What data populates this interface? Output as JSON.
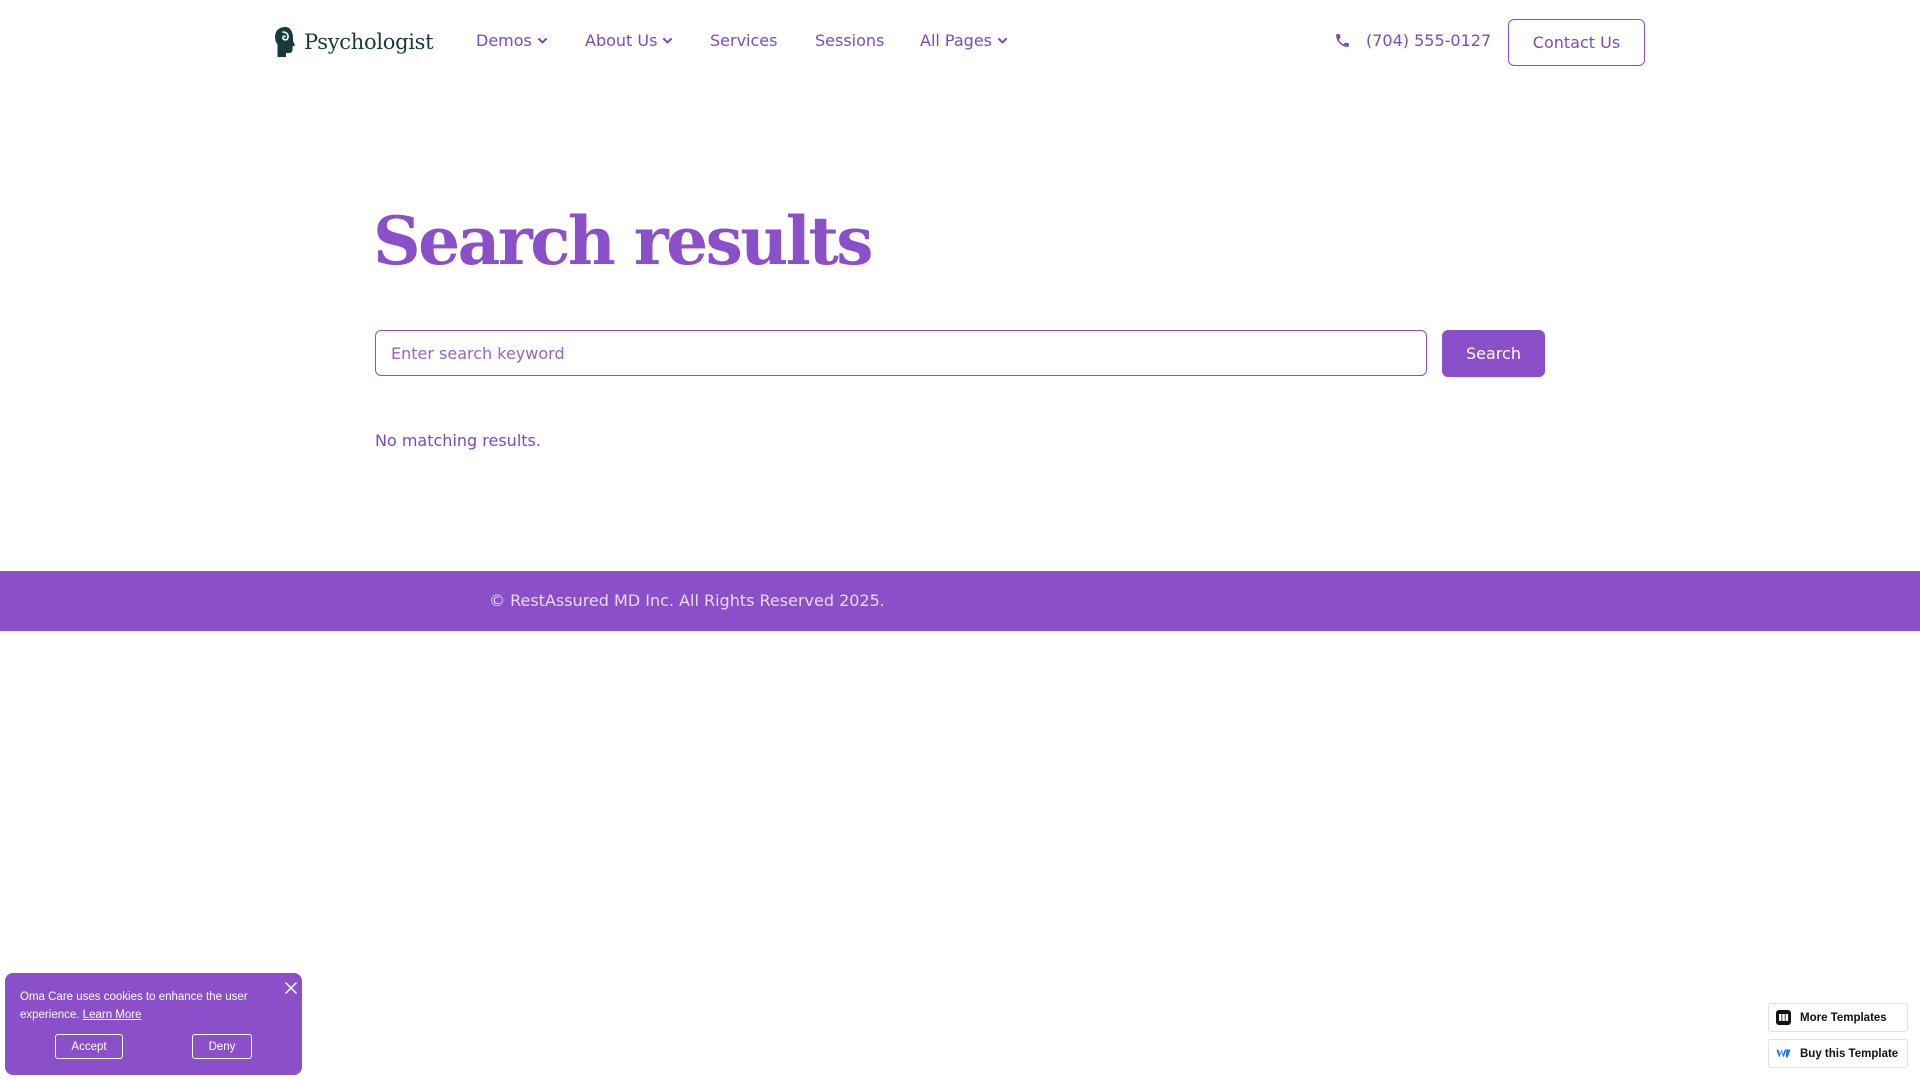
{
  "header": {
    "logo_text": "Psychologist",
    "nav": [
      {
        "label": "Demos",
        "has_dropdown": true
      },
      {
        "label": "About Us",
        "has_dropdown": true
      },
      {
        "label": "Services",
        "has_dropdown": false
      },
      {
        "label": "Sessions",
        "has_dropdown": false
      },
      {
        "label": "All Pages",
        "has_dropdown": true
      }
    ],
    "phone": "(704) 555-0127",
    "contact_label": "Contact Us"
  },
  "main": {
    "title": "Search results",
    "search_placeholder": "Enter search keyword",
    "search_value": "",
    "search_button": "Search",
    "no_results": "No matching results."
  },
  "footer": {
    "copyright": "© RestAssured MD Inc. All Rights Reserved 2025."
  },
  "cookie_banner": {
    "text": "Oma Care uses cookies to enhance the user experience.",
    "learn_more": "Learn More",
    "accept": "Accept",
    "deny": "Deny"
  },
  "badges": {
    "more_templates": "More Templates",
    "buy_template": "Buy this Template"
  },
  "colors": {
    "accent": "#8a4fc9",
    "nav_text": "#7d4bb8",
    "logo_dark": "#173a3a",
    "footer_text": "#e8dcf6"
  },
  "icons": {
    "logo": "head-silhouette-icon",
    "phone": "phone-icon",
    "dropdown": "chevron-down-icon",
    "close": "close-icon",
    "more_templates": "template-grid-icon",
    "buy_template": "webflow-logo-icon"
  }
}
